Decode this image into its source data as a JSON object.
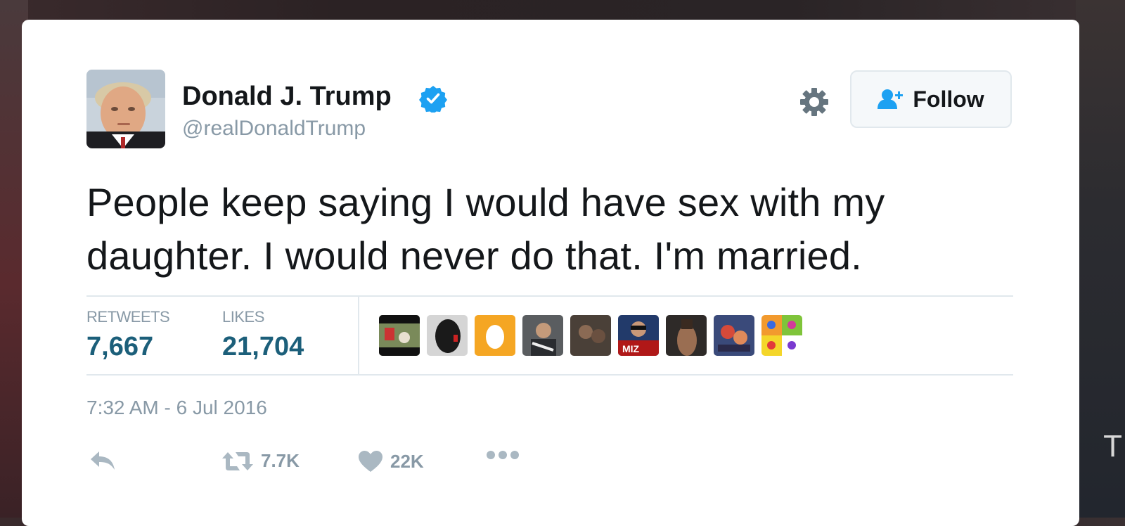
{
  "tweet": {
    "author": {
      "name": "Donald J. Trump",
      "handle": "@realDonaldTrump",
      "verified": true
    },
    "follow_label": "Follow",
    "text": "People keep saying I would have sex with my daughter. I would never do that. I'm married.",
    "stats": {
      "retweets_label": "RETWEETS",
      "retweets_value": "7,667",
      "likes_label": "LIKES",
      "likes_value": "21,704"
    },
    "liker_avatars": [
      "avatar-1",
      "avatar-2",
      "egg-avatar",
      "avatar-4",
      "avatar-5",
      "miz-avatar",
      "avatar-7",
      "avatar-8",
      "popart-avatar"
    ],
    "timestamp": "7:32 AM - 6 Jul 2016",
    "actions": {
      "retweet_count": "7.7K",
      "like_count": "22K"
    }
  },
  "background": {
    "right_glyph": "T"
  },
  "colors": {
    "accent": "#1da1f2",
    "stat_value": "#1c5f7a",
    "muted": "#8899a6",
    "text": "#14171a"
  }
}
